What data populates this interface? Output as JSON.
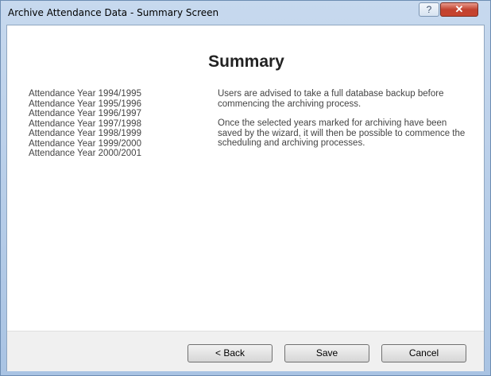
{
  "window": {
    "title": "Archive Attendance Data - Summary Screen",
    "help_label": "?",
    "close_label": "✕"
  },
  "main": {
    "heading": "Summary",
    "years": [
      "Attendance Year 1994/1995",
      "Attendance Year 1995/1996",
      "Attendance Year 1996/1997",
      "Attendance Year 1997/1998",
      "Attendance Year 1998/1999",
      "Attendance Year 1999/2000",
      "Attendance Year 2000/2001"
    ],
    "note1": "Users are advised to take a full database backup before commencing the archiving process.",
    "note2": "Once the selected years marked for archiving have been saved by the wizard, it will then be possible to commence the scheduling and archiving processes."
  },
  "footer": {
    "back_label": "< Back",
    "save_label": "Save",
    "cancel_label": "Cancel"
  }
}
